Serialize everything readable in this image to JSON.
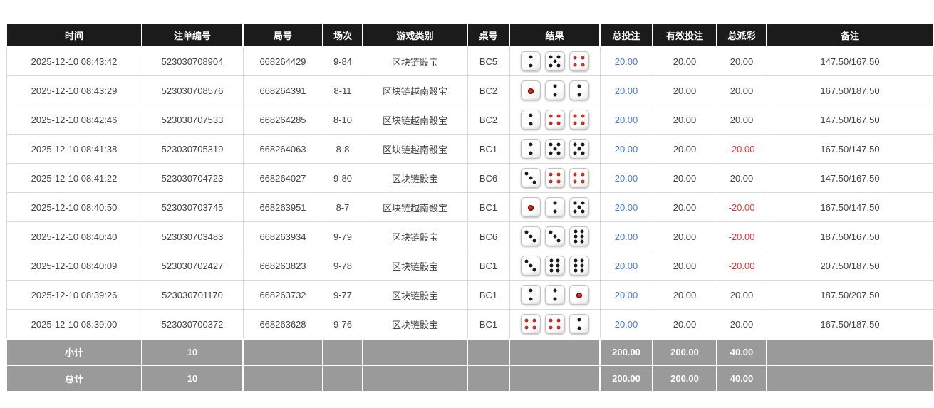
{
  "colors": {
    "header_bg": "#1b1b1b",
    "header_text": "#ffffff",
    "row_bg": "#ffffff",
    "row_border": "#d9d9d9",
    "summary_bg": "#9a9a9a",
    "summary_text": "#ffffff",
    "total_bet_link_blue": "#4a7dd6",
    "negative_amount_red": "#ee3333",
    "die_pip_black": "#1a1a1a",
    "die_pip_red": "#a50d00"
  },
  "table": {
    "columns": [
      {
        "key": "time",
        "label": "时间"
      },
      {
        "key": "bet_id",
        "label": "注单编号"
      },
      {
        "key": "round_id",
        "label": "局号"
      },
      {
        "key": "session",
        "label": "场次"
      },
      {
        "key": "game_type",
        "label": "游戏类别"
      },
      {
        "key": "table_no",
        "label": "桌号"
      },
      {
        "key": "result",
        "label": "结果"
      },
      {
        "key": "total_bet",
        "label": "总投注"
      },
      {
        "key": "valid_bet",
        "label": "有效投注"
      },
      {
        "key": "total_payout",
        "label": "总派彩"
      },
      {
        "key": "remark",
        "label": "备注"
      }
    ],
    "rows": [
      {
        "time": "2025-12-10 08:43:42",
        "bet_id": "523030708904",
        "round_id": "668264429",
        "session": "9-84",
        "game_type": "区块链骰宝",
        "table_no": "BC5",
        "dice": [
          2,
          5,
          4
        ],
        "total_bet": "20.00",
        "valid_bet": "20.00",
        "total_payout": "20.00",
        "remark": "147.50/167.50"
      },
      {
        "time": "2025-12-10 08:43:29",
        "bet_id": "523030708576",
        "round_id": "668264391",
        "session": "8-11",
        "game_type": "区块链越南骰宝",
        "table_no": "BC2",
        "dice": [
          1,
          2,
          2
        ],
        "total_bet": "20.00",
        "valid_bet": "20.00",
        "total_payout": "20.00",
        "remark": "167.50/187.50"
      },
      {
        "time": "2025-12-10 08:42:46",
        "bet_id": "523030707533",
        "round_id": "668264285",
        "session": "8-10",
        "game_type": "区块链越南骰宝",
        "table_no": "BC2",
        "dice": [
          2,
          4,
          4
        ],
        "total_bet": "20.00",
        "valid_bet": "20.00",
        "total_payout": "20.00",
        "remark": "147.50/167.50"
      },
      {
        "time": "2025-12-10 08:41:38",
        "bet_id": "523030705319",
        "round_id": "668264063",
        "session": "8-8",
        "game_type": "区块链越南骰宝",
        "table_no": "BC1",
        "dice": [
          2,
          5,
          5
        ],
        "total_bet": "20.00",
        "valid_bet": "20.00",
        "total_payout": "-20.00",
        "remark": "167.50/147.50"
      },
      {
        "time": "2025-12-10 08:41:22",
        "bet_id": "523030704723",
        "round_id": "668264027",
        "session": "9-80",
        "game_type": "区块链骰宝",
        "table_no": "BC6",
        "dice": [
          3,
          4,
          4
        ],
        "total_bet": "20.00",
        "valid_bet": "20.00",
        "total_payout": "20.00",
        "remark": "147.50/167.50"
      },
      {
        "time": "2025-12-10 08:40:50",
        "bet_id": "523030703745",
        "round_id": "668263951",
        "session": "8-7",
        "game_type": "区块链越南骰宝",
        "table_no": "BC1",
        "dice": [
          1,
          2,
          5
        ],
        "total_bet": "20.00",
        "valid_bet": "20.00",
        "total_payout": "-20.00",
        "remark": "167.50/147.50"
      },
      {
        "time": "2025-12-10 08:40:40",
        "bet_id": "523030703483",
        "round_id": "668263934",
        "session": "9-79",
        "game_type": "区块链骰宝",
        "table_no": "BC6",
        "dice": [
          3,
          3,
          6
        ],
        "total_bet": "20.00",
        "valid_bet": "20.00",
        "total_payout": "-20.00",
        "remark": "187.50/167.50"
      },
      {
        "time": "2025-12-10 08:40:09",
        "bet_id": "523030702427",
        "round_id": "668263823",
        "session": "9-78",
        "game_type": "区块链骰宝",
        "table_no": "BC1",
        "dice": [
          3,
          6,
          6
        ],
        "total_bet": "20.00",
        "valid_bet": "20.00",
        "total_payout": "-20.00",
        "remark": "207.50/187.50"
      },
      {
        "time": "2025-12-10 08:39:26",
        "bet_id": "523030701170",
        "round_id": "668263732",
        "session": "9-77",
        "game_type": "区块链骰宝",
        "table_no": "BC1",
        "dice": [
          2,
          2,
          1
        ],
        "total_bet": "20.00",
        "valid_bet": "20.00",
        "total_payout": "20.00",
        "remark": "187.50/207.50"
      },
      {
        "time": "2025-12-10 08:39:00",
        "bet_id": "523030700372",
        "round_id": "668263628",
        "session": "9-76",
        "game_type": "区块链骰宝",
        "table_no": "BC1",
        "dice": [
          4,
          4,
          2
        ],
        "total_bet": "20.00",
        "valid_bet": "20.00",
        "total_payout": "20.00",
        "remark": "167.50/187.50"
      }
    ],
    "summary_rows": [
      {
        "label": "小计",
        "count": "10",
        "total_bet": "200.00",
        "valid_bet": "200.00",
        "total_payout": "40.00"
      },
      {
        "label": "总计",
        "count": "10",
        "total_bet": "200.00",
        "valid_bet": "200.00",
        "total_payout": "40.00"
      }
    ]
  }
}
